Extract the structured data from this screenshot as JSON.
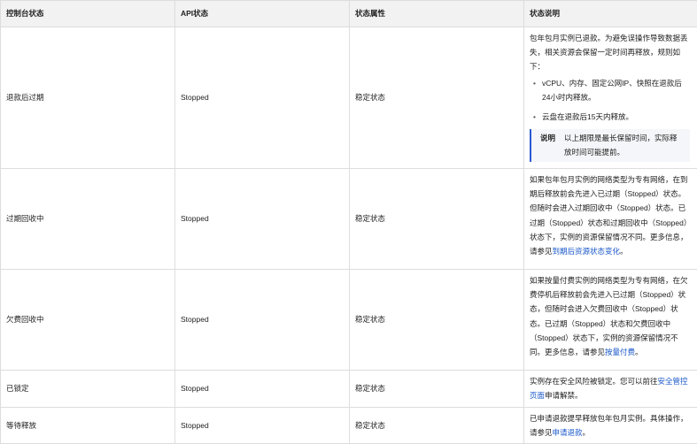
{
  "headers": [
    "控制台状态",
    "API状态",
    "状态属性",
    "状态说明"
  ],
  "rows": [
    {
      "console": "退款后过期",
      "api": "Stopped",
      "attr": "稳定状态",
      "intro": "包年包月实例已退款。为避免误操作导致数据丢失，相关资源会保留一定时间再释放，规则如下：",
      "bullets": [
        "vCPU、内存、固定公网IP、快照在退款后24小时内释放。",
        "云盘在退款后15天内释放。"
      ],
      "note_title": "说明",
      "note_text": "以上期限是最长保留时间，实际释放时间可能提前。"
    },
    {
      "console": "过期回收中",
      "api": "Stopped",
      "attr": "稳定状态",
      "desc_pre": "如果包年包月实例的网络类型为专有网络，在到期后释放前会先进入已过期（Stopped）状态。但随时会进入过期回收中（Stopped）状态。已过期（Stopped）状态和过期回收中（Stopped）状态下，实例的资源保留情况不同。更多信息，请参见",
      "link": "到期后资源状态变化",
      "desc_post": "。"
    },
    {
      "console": "欠费回收中",
      "api": "Stopped",
      "attr": "稳定状态",
      "desc_pre": "如果按量付费实例的网络类型为专有网络，在欠费停机后释放前会先进入已过期（Stopped）状态，但随时会进入欠费回收中（Stopped）状态。已过期（Stopped）状态和欠费回收中（Stopped）状态下，实例的资源保留情况不同。更多信息，请参见",
      "link": "按量付费",
      "desc_post": "。"
    },
    {
      "console": "已锁定",
      "api": "Stopped",
      "attr": "稳定状态",
      "desc_pre": "实例存在安全风险被锁定。您可以前往",
      "link": "安全管控页面",
      "desc_post": "申请解禁。"
    },
    {
      "console": "等待释放",
      "api": "Stopped",
      "attr": "稳定状态",
      "desc_pre": "已申请退款提早释放包年包月实例。具体操作，请参见",
      "link": "申请退款",
      "desc_post": "。"
    }
  ]
}
